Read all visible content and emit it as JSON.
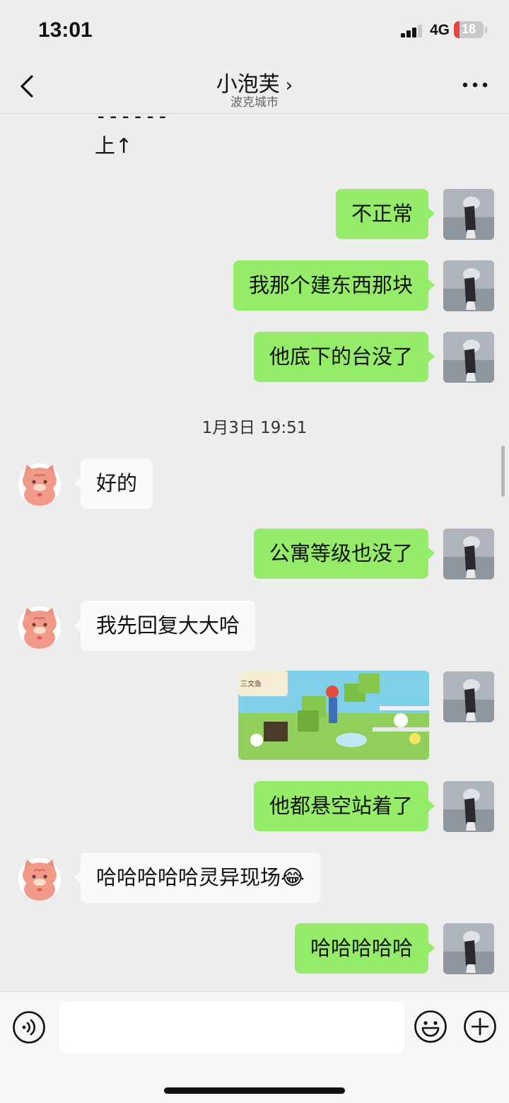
{
  "status_bar": {
    "time": "13:01",
    "network": "4G",
    "battery": "18",
    "battery_level": 0.18,
    "battery_color": "#e8453c"
  },
  "header": {
    "title": "小泡芙",
    "title_chevron": "›",
    "subtitle": "波克城市",
    "back_icon": "chevron-left-icon",
    "more_icon": "ellipsis-icon"
  },
  "messages": {
    "dash_text": "------",
    "up_text": "上↑",
    "m1": "不正常",
    "m2": "我那个建东西那块",
    "m3": "他底下的台没了",
    "timestamp": "1月3日 19:51",
    "m4": "好的",
    "m5": "公寓等级也没了",
    "m6": "我先回复大大哈",
    "m7_image_label": "三文鱼",
    "m8": "他都悬空站着了",
    "m9": "哈哈哈哈哈灵异现场😂",
    "m10": "哈哈哈哈哈"
  },
  "colors": {
    "my_bubble": "#95ec69",
    "other_bubble": "#fafafa",
    "background": "#ededed"
  },
  "input_bar": {
    "voice_icon": "voice-icon",
    "emoji_icon": "emoji-icon",
    "plus_icon": "plus-icon"
  }
}
